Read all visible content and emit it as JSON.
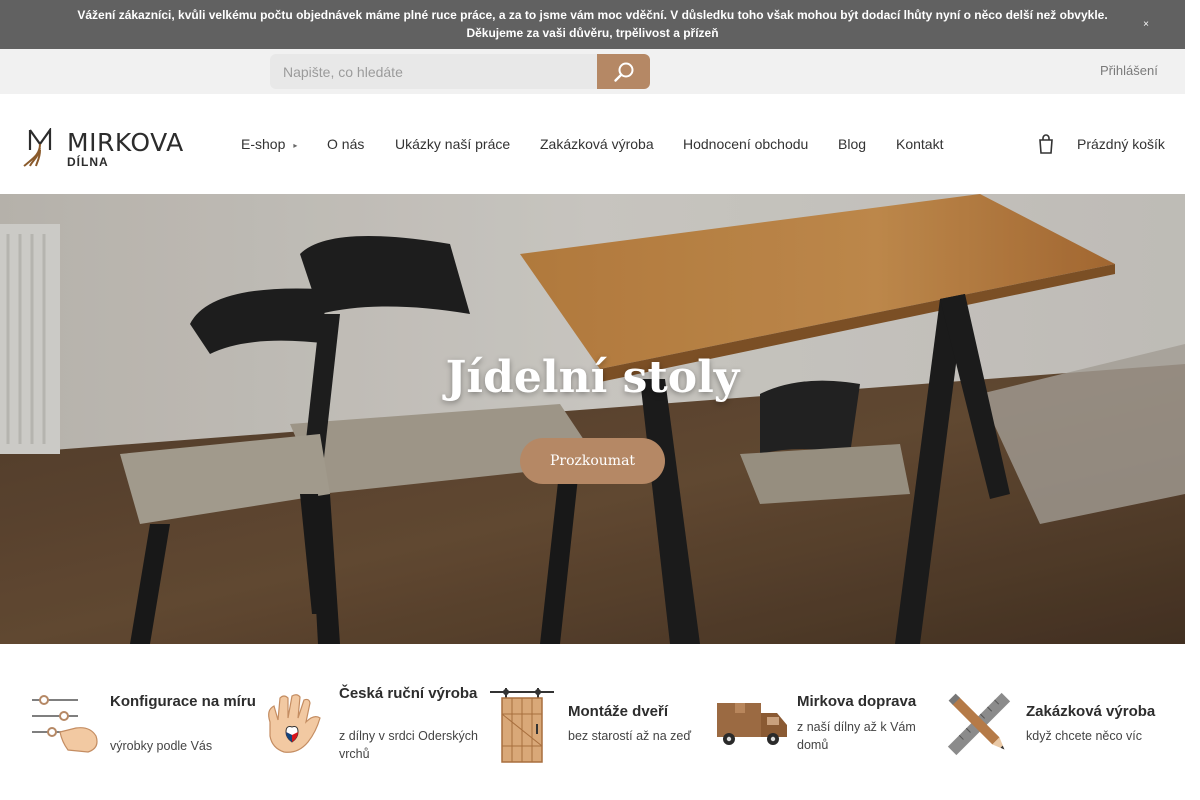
{
  "notice": {
    "line1": "Vážení zákazníci, kvůli velkému počtu objednávek máme plné ruce práce, a za to jsme vám moc vděční. V důsledku toho však mohou být dodací lhůty nyní o něco delší než obvykle.",
    "line2": "Děkujeme za vaši důvěru, trpělivost a přízeň",
    "close_glyph": "×"
  },
  "search": {
    "placeholder": "Napište, co hledáte"
  },
  "account": {
    "login_label": "Přihlášení"
  },
  "logo": {
    "name": "MIRKOVA",
    "subtitle": "DÍLNA"
  },
  "nav": {
    "items": [
      {
        "label": "E-shop",
        "has_dropdown": true
      },
      {
        "label": "O nás"
      },
      {
        "label": "Ukázky naší práce"
      },
      {
        "label": "Zakázková výroba"
      },
      {
        "label": "Hodnocení obchodu"
      },
      {
        "label": "Blog"
      },
      {
        "label": "Kontakt"
      }
    ],
    "dropdown_glyph": "▸"
  },
  "cart": {
    "label": "Prázdný košík"
  },
  "hero": {
    "title": "Jídelní stoly",
    "button": "Prozkoumat"
  },
  "features": [
    {
      "icon": "sliders-hand-icon",
      "title": "Konfigurace na míru",
      "subtitle": "výrobky podle Vás"
    },
    {
      "icon": "czech-heart-hand-icon",
      "title": "Česká ruční výroba",
      "subtitle": "z dílny v srdci Oderských vrchů"
    },
    {
      "icon": "sliding-door-icon",
      "title": "Montáže dveří",
      "subtitle": "bez starostí až na zeď"
    },
    {
      "icon": "delivery-truck-icon",
      "title": "Mirkova doprava",
      "subtitle": "z naší dílny až k Vám domů"
    },
    {
      "icon": "ruler-pencil-icon",
      "title": "Zakázková výroba",
      "subtitle": "když chcete něco víc"
    }
  ],
  "colors": {
    "accent": "#b58865",
    "notice_bg": "#616161",
    "topbar_bg": "#f1f1f1"
  }
}
